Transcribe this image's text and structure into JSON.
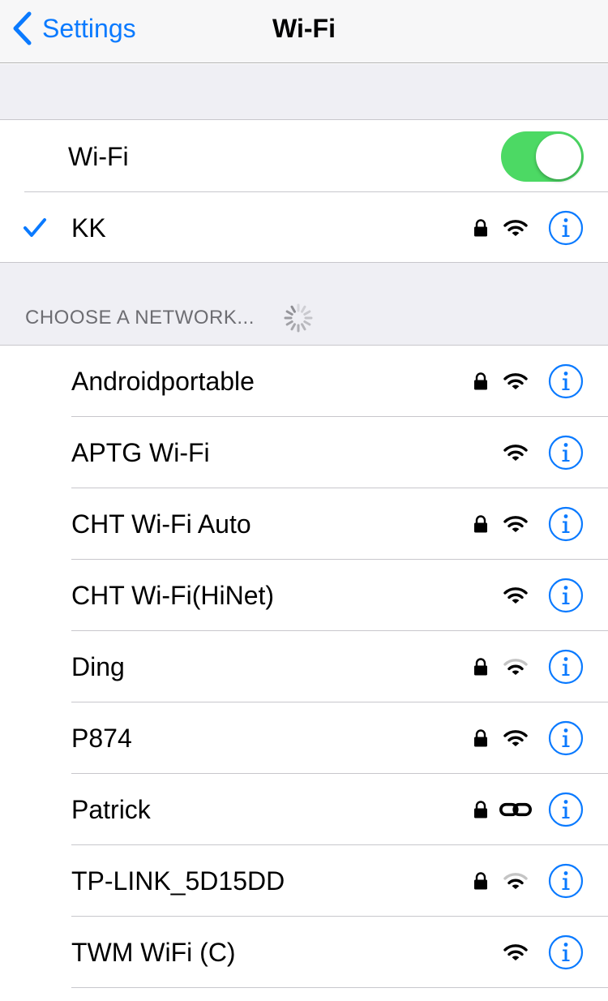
{
  "navbar": {
    "back_label": "Settings",
    "title": "Wi-Fi"
  },
  "wifi_toggle": {
    "label": "Wi-Fi",
    "on": true,
    "on_color": "#4cd964"
  },
  "current_network": {
    "name": "KK",
    "locked": true,
    "icon": "wifi-full"
  },
  "section": {
    "header": "CHOOSE A NETWORK..."
  },
  "networks": [
    {
      "name": "Androidportable",
      "locked": true,
      "icon": "wifi-full"
    },
    {
      "name": "APTG Wi-Fi",
      "locked": false,
      "icon": "wifi-full"
    },
    {
      "name": "CHT Wi-Fi Auto",
      "locked": true,
      "icon": "wifi-full"
    },
    {
      "name": "CHT Wi-Fi(HiNet)",
      "locked": false,
      "icon": "wifi-full"
    },
    {
      "name": "Ding",
      "locked": true,
      "icon": "wifi-two-bars"
    },
    {
      "name": "P874",
      "locked": true,
      "icon": "wifi-full"
    },
    {
      "name": "Patrick",
      "locked": true,
      "icon": "chain-link"
    },
    {
      "name": "TP-LINK_5D15DD",
      "locked": true,
      "icon": "wifi-two-bars"
    },
    {
      "name": "TWM WiFi (C)",
      "locked": false,
      "icon": "wifi-full"
    }
  ],
  "colors": {
    "accent": "#0a7aff",
    "background_grouped": "#efeff4",
    "separator": "#c8c7cc"
  }
}
